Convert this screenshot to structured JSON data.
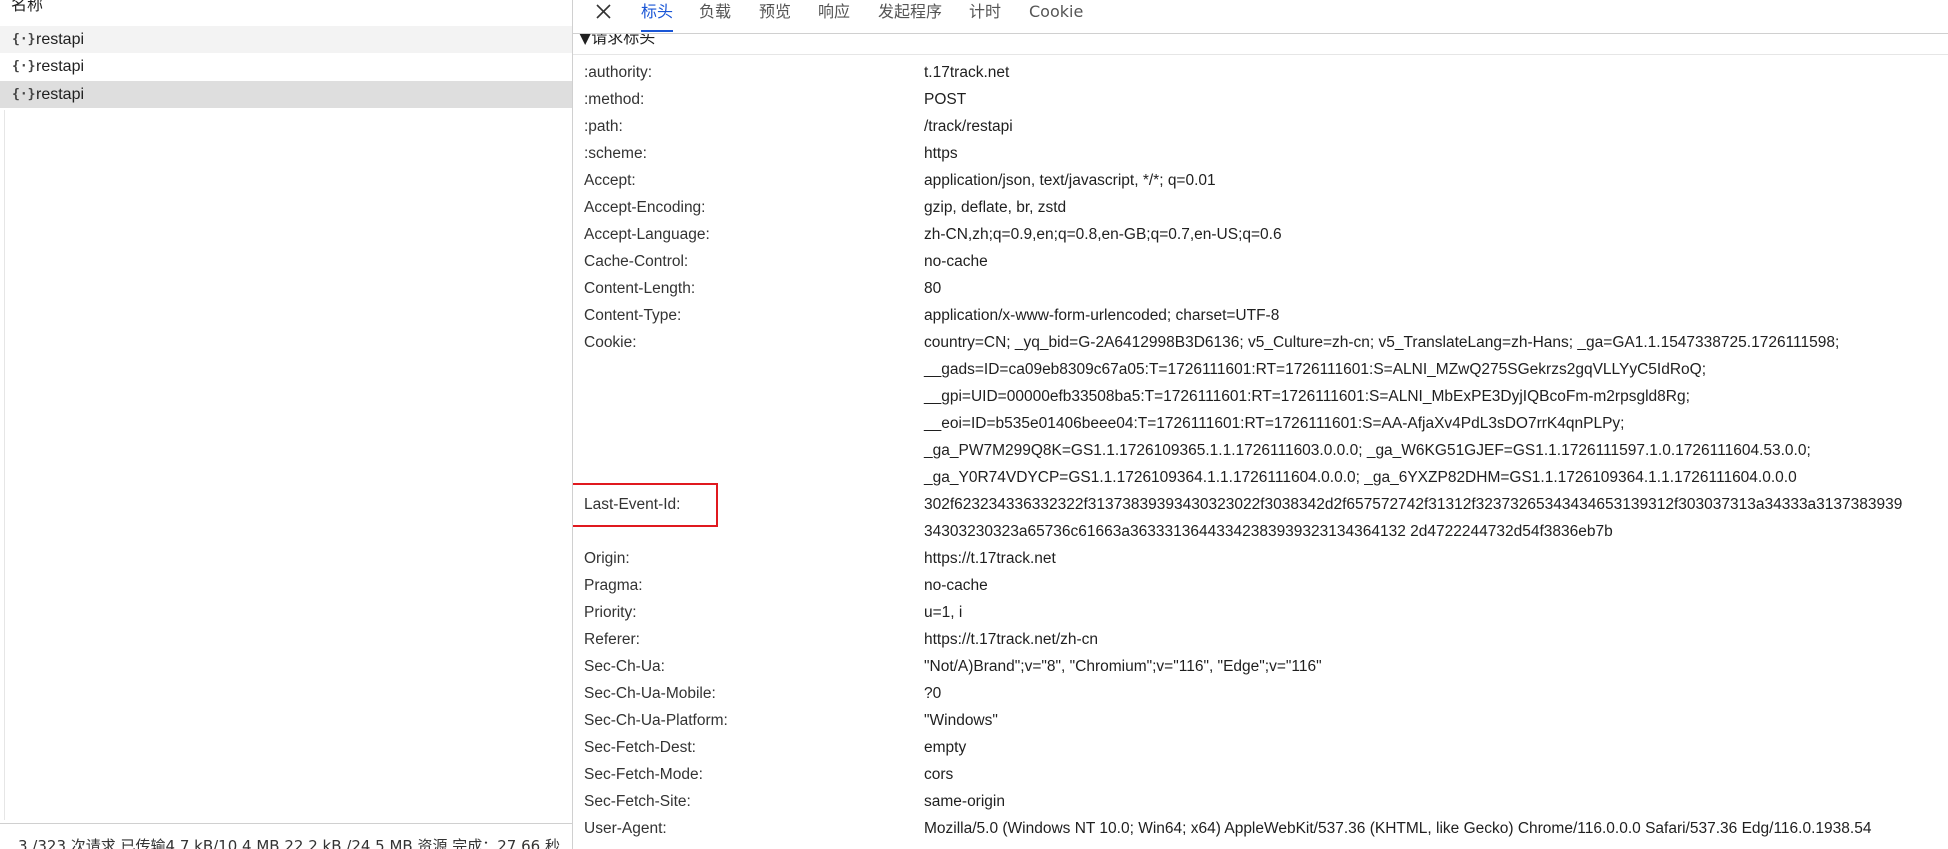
{
  "left_pane": {
    "name_header": "名称",
    "requests": [
      {
        "icon": "json-icon",
        "icon_glyph": "{·}",
        "name": "restapi"
      },
      {
        "icon": "json-icon",
        "icon_glyph": "{·}",
        "name": "restapi"
      },
      {
        "icon": "json-icon",
        "icon_glyph": "{·}",
        "name": "restapi"
      }
    ],
    "summary": "3 /323 次请求  已传输4.7 kB/10.4 MB  22.2 kB /24.5 MB 资源  完成：27.66 秒"
  },
  "tabs": {
    "close_icon": "close-icon",
    "items": [
      "标头",
      "负载",
      "预览",
      "响应",
      "发起程序",
      "计时",
      "Cookie"
    ],
    "active": "标头",
    "active_color": "#1a56d6"
  },
  "section": {
    "title": "▼请求标头"
  },
  "headers": [
    {
      "name": ":authority:",
      "values": [
        "t.17track.net"
      ]
    },
    {
      "name": ":method:",
      "values": [
        "POST"
      ]
    },
    {
      "name": ":path:",
      "values": [
        "/track/restapi"
      ]
    },
    {
      "name": ":scheme:",
      "values": [
        "https"
      ]
    },
    {
      "name": "Accept:",
      "values": [
        "application/json, text/javascript, */*; q=0.01"
      ]
    },
    {
      "name": "Accept-Encoding:",
      "values": [
        "gzip, deflate, br, zstd"
      ]
    },
    {
      "name": "Accept-Language:",
      "values": [
        "zh-CN,zh;q=0.9,en;q=0.8,en-GB;q=0.7,en-US;q=0.6"
      ]
    },
    {
      "name": "Cache-Control:",
      "values": [
        "no-cache"
      ]
    },
    {
      "name": "Content-Length:",
      "values": [
        "80"
      ]
    },
    {
      "name": "Content-Type:",
      "values": [
        "application/x-www-form-urlencoded; charset=UTF-8"
      ]
    },
    {
      "name": "Cookie:",
      "values": [
        "country=CN; _yq_bid=G-2A6412998B3D6136; v5_Culture=zh-cn; v5_TranslateLang=zh-Hans; _ga=GA1.1.1547338725.1726111598;",
        "__gads=ID=ca09eb8309c67a05:T=1726111601:RT=1726111601:S=ALNI_MZwQ275SGekrzs2gqVLLYyC5IdRoQ;",
        "__gpi=UID=00000efb33508ba5:T=1726111601:RT=1726111601:S=ALNI_MbExPE3DyjIQBcoFm-m2rpsgld8Rg;",
        "__eoi=ID=b535e01406beee04:T=1726111601:RT=1726111601:S=AA-AfjaXv4PdL3sDO7rrK4qnPLPy;",
        "_ga_PW7M299Q8K=GS1.1.1726109365.1.1.1726111603.0.0.0; _ga_W6KG51GJEF=GS1.1.1726111597.1.0.1726111604.53.0.0;",
        "_ga_Y0R74VDYCP=GS1.1.1726109364.1.1.1726111604.0.0.0; _ga_6YXZP82DHM=GS1.1.1726109364.1.1.1726111604.0.0.0"
      ]
    },
    {
      "name": "Last-Event-Id:",
      "highlighted": true,
      "values": [
        "302f623234336332322f31373839393430323022f3038342d2f657572742f31312f32373265343434653139312f303037313a34333a3137383939",
        "34303230323a65736c61663a36333136443342383939323134364132 2d4722244732d54f3836eb7b"
      ]
    },
    {
      "name": "Origin:",
      "values": [
        "https://t.17track.net"
      ]
    },
    {
      "name": "Pragma:",
      "values": [
        "no-cache"
      ]
    },
    {
      "name": "Priority:",
      "values": [
        "u=1, i"
      ]
    },
    {
      "name": "Referer:",
      "values": [
        "https://t.17track.net/zh-cn"
      ]
    },
    {
      "name": "Sec-Ch-Ua:",
      "values": [
        "\"Not/A)Brand\";v=\"8\", \"Chromium\";v=\"116\", \"Edge\";v=\"116\""
      ]
    },
    {
      "name": "Sec-Ch-Ua-Mobile:",
      "values": [
        "?0"
      ]
    },
    {
      "name": "Sec-Ch-Ua-Platform:",
      "values": [
        "\"Windows\""
      ]
    },
    {
      "name": "Sec-Fetch-Dest:",
      "values": [
        "empty"
      ]
    },
    {
      "name": "Sec-Fetch-Mode:",
      "values": [
        "cors"
      ]
    },
    {
      "name": "Sec-Fetch-Site:",
      "values": [
        "same-origin"
      ]
    },
    {
      "name": "User-Agent:",
      "values": [
        "Mozilla/5.0 (Windows NT 10.0; Win64; x64) AppleWebKit/537.36 (KHTML, like Gecko) Chrome/116.0.0.0 Safari/537.36 Edg/116.0.1938.54"
      ]
    }
  ],
  "highlight_color": "#e0191f"
}
